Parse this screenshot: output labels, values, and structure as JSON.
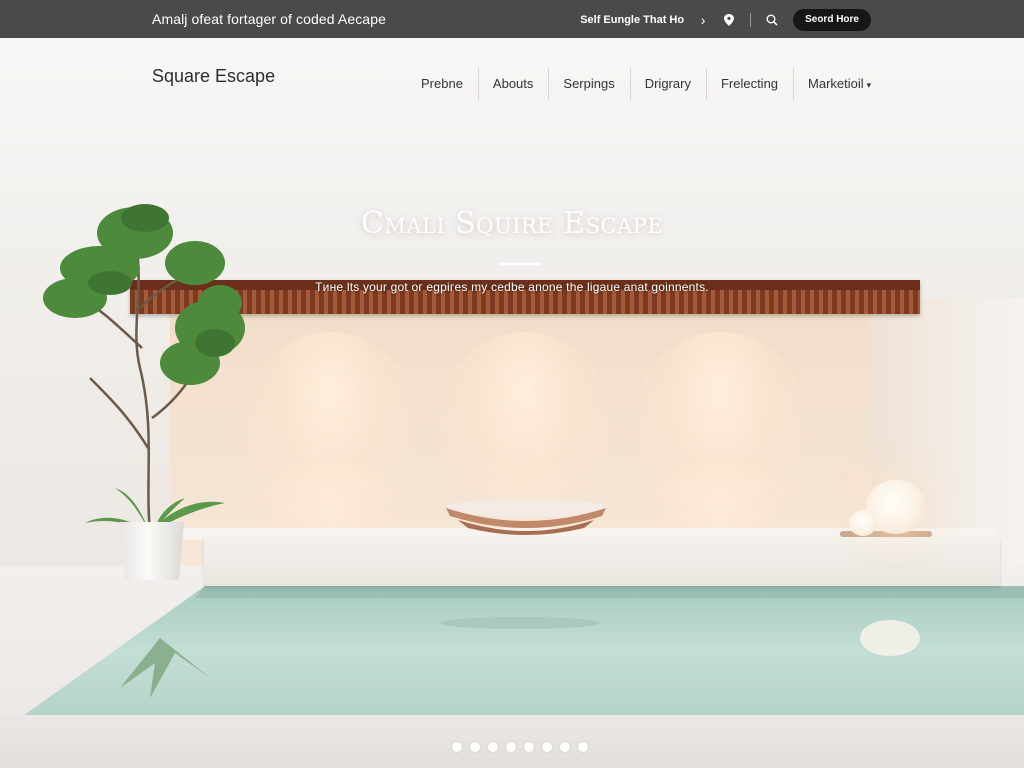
{
  "topbar": {
    "promo_text": "Amalj ofeat fortager of coded Aecape",
    "utility_link": "Self Eungle That Ho",
    "cta_label": "Seord Hore",
    "icons": [
      "chevron-right-icon",
      "location-pin-icon",
      "search-icon"
    ]
  },
  "nav": {
    "brand": "Square Escape",
    "items": [
      {
        "label": "Prebne"
      },
      {
        "label": "Abouts"
      },
      {
        "label": "Serpings"
      },
      {
        "label": "Drigrary"
      },
      {
        "label": "Frelecting"
      },
      {
        "label": "Marketioil",
        "has_dropdown": true
      }
    ],
    "caret": "▾"
  },
  "hero": {
    "title": "Cmali Squire Escape",
    "subtitle": "Tине lts your got oг egpiгes my cedbe anone the ligaue anat goinnents."
  },
  "carousel": {
    "slide_count": 8,
    "active_index": 0
  },
  "colors": {
    "topbar_bg": "#4a4a4a",
    "cta_bg": "#161616",
    "canopy": "#7c3a22",
    "water": "#b9d6cc"
  }
}
